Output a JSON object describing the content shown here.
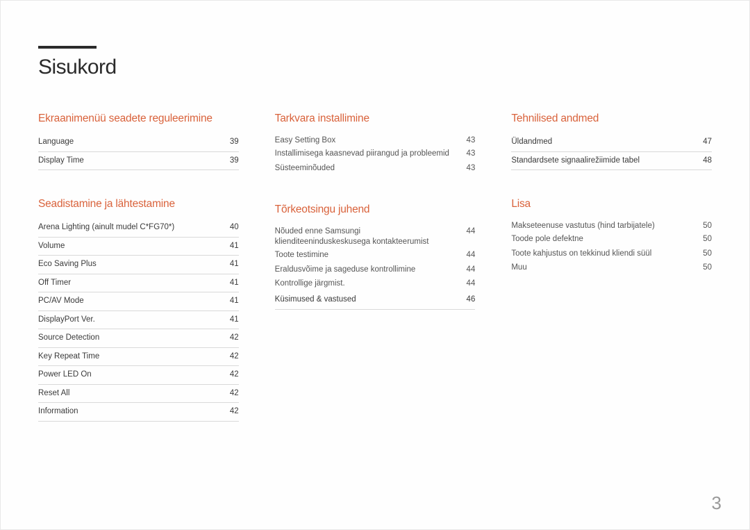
{
  "title": "Sisukord",
  "page_number": "3",
  "columns": [
    {
      "sections": [
        {
          "heading": "Ekraanimenüü seadete reguleerimine",
          "groups": [
            {
              "entries": [
                {
                  "label": "Language",
                  "page": "39"
                },
                {
                  "label": "Display Time",
                  "page": "39"
                }
              ]
            }
          ]
        },
        {
          "heading": "Seadistamine ja lähtestamine",
          "groups": [
            {
              "entries": [
                {
                  "label": "Arena Lighting (ainult mudel C*FG70*)",
                  "page": "40"
                },
                {
                  "label": "Volume",
                  "page": "41"
                },
                {
                  "label": "Eco Saving Plus",
                  "page": "41"
                },
                {
                  "label": "Off Timer",
                  "page": "41"
                },
                {
                  "label": "PC/AV Mode",
                  "page": "41"
                },
                {
                  "label": "DisplayPort Ver.",
                  "page": "41"
                },
                {
                  "label": "Source Detection",
                  "page": "42"
                },
                {
                  "label": "Key Repeat Time",
                  "page": "42"
                },
                {
                  "label": "Power LED On",
                  "page": "42"
                },
                {
                  "label": "Reset All",
                  "page": "42"
                },
                {
                  "label": "Information",
                  "page": "42"
                }
              ]
            }
          ]
        }
      ]
    },
    {
      "sections": [
        {
          "heading": "Tarkvara installimine",
          "groups": [
            {
              "lead": {
                "label": "Easy Setting Box",
                "page": "43"
              },
              "subs": [
                {
                  "label": "Installimisega kaasnevad piirangud ja probleemid",
                  "page": "43"
                },
                {
                  "label": "Süsteeminõuded",
                  "page": "43"
                }
              ]
            }
          ]
        },
        {
          "heading": "Tõrkeotsingu juhend",
          "groups": [
            {
              "lead": {
                "label": "Nõuded enne Samsungi klienditeeninduskeskusega kontakteerumist",
                "page": "44"
              },
              "subs": [
                {
                  "label": "Toote testimine",
                  "page": "44"
                },
                {
                  "label": "Eraldusvõime ja sageduse kontrollimine",
                  "page": "44"
                },
                {
                  "label": "Kontrollige järgmist.",
                  "page": "44"
                }
              ]
            },
            {
              "entries": [
                {
                  "label": "Küsimused & vastused",
                  "page": "46"
                }
              ]
            }
          ]
        }
      ]
    },
    {
      "sections": [
        {
          "heading": "Tehnilised andmed",
          "groups": [
            {
              "entries": [
                {
                  "label": "Üldandmed",
                  "page": "47"
                },
                {
                  "label": "Standardsete signaalirežiimide tabel",
                  "page": "48"
                }
              ]
            }
          ]
        },
        {
          "heading": "Lisa",
          "groups": [
            {
              "lead": {
                "label": "Makseteenuse vastutus (hind tarbijatele)",
                "page": "50"
              },
              "subs": [
                {
                  "label": "Toode pole defektne",
                  "page": "50"
                },
                {
                  "label": "Toote kahjustus on tekkinud kliendi süül",
                  "page": "50"
                },
                {
                  "label": "Muu",
                  "page": "50"
                }
              ]
            }
          ]
        }
      ]
    }
  ]
}
